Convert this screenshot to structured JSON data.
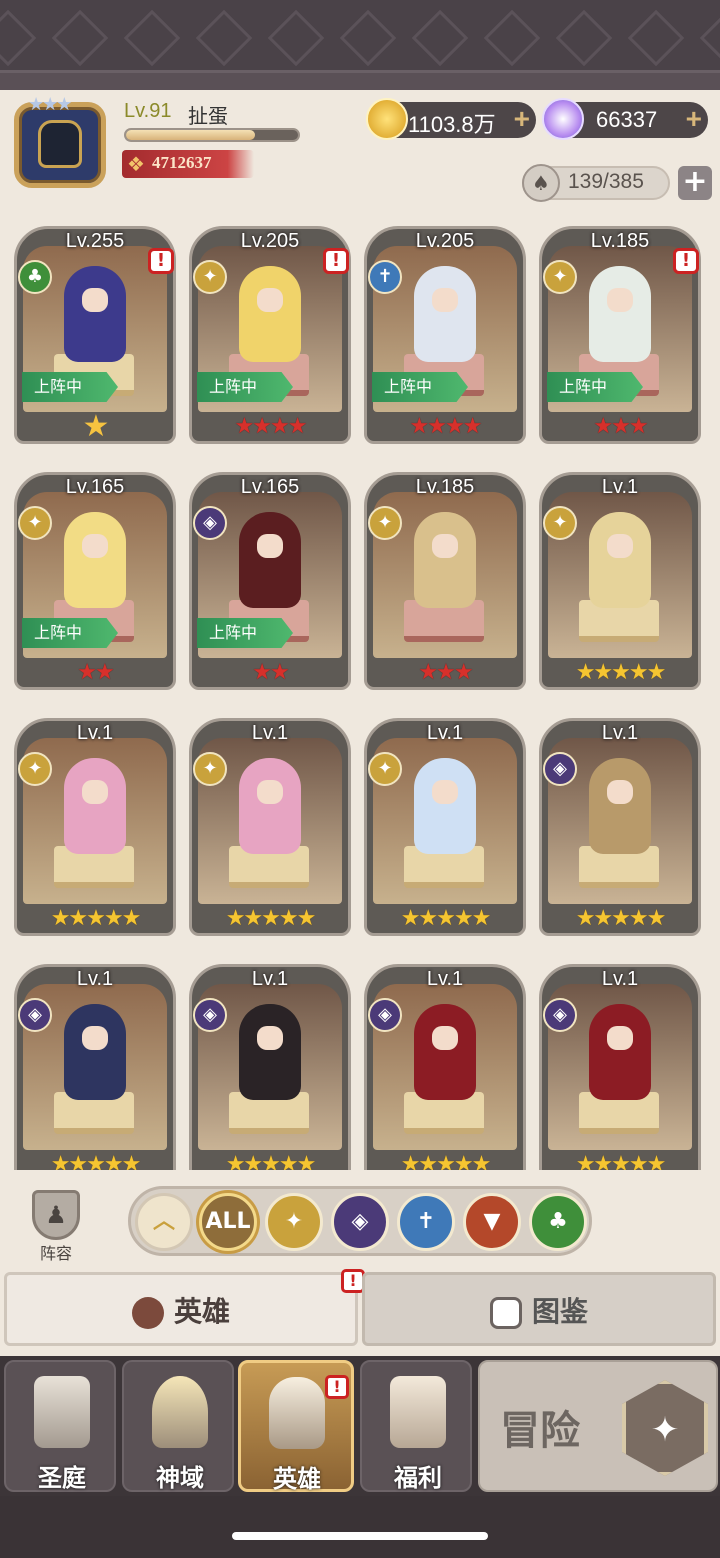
{
  "player": {
    "level": "Lv.91",
    "name": "扯蛋",
    "xp_fraction": 0.75,
    "power": "4712637"
  },
  "currency": {
    "gold": "1103.8万",
    "gems": "66337"
  },
  "capacity": "139/385",
  "heroes": [
    {
      "level": "Lv.255",
      "class": "nature",
      "alert": true,
      "deployed": true,
      "stars": "★",
      "star_style": "purple-wing"
    },
    {
      "level": "Lv.205",
      "class": "light",
      "alert": true,
      "deployed": true,
      "stars": "★★★★",
      "star_style": "red"
    },
    {
      "level": "Lv.205",
      "class": "holy",
      "alert": false,
      "deployed": true,
      "stars": "★★★★",
      "star_style": "red"
    },
    {
      "level": "Lv.185",
      "class": "light",
      "alert": true,
      "deployed": true,
      "stars": "★★★",
      "star_style": "red"
    },
    {
      "level": "Lv.165",
      "class": "light",
      "alert": false,
      "deployed": true,
      "stars": "★★",
      "star_style": "red"
    },
    {
      "level": "Lv.165",
      "class": "dark",
      "alert": false,
      "deployed": true,
      "stars": "★★",
      "star_style": "red"
    },
    {
      "level": "Lv.185",
      "class": "light",
      "alert": false,
      "deployed": false,
      "stars": "★★★",
      "star_style": "red"
    },
    {
      "level": "Lv.1",
      "class": "light",
      "alert": false,
      "deployed": false,
      "stars": "★★★★★",
      "star_style": "yellow"
    },
    {
      "level": "Lv.1",
      "class": "light",
      "alert": false,
      "deployed": false,
      "stars": "★★★★★",
      "star_style": "yellow"
    },
    {
      "level": "Lv.1",
      "class": "light",
      "alert": false,
      "deployed": false,
      "stars": "★★★★★",
      "star_style": "yellow"
    },
    {
      "level": "Lv.1",
      "class": "light",
      "alert": false,
      "deployed": false,
      "stars": "★★★★★",
      "star_style": "yellow"
    },
    {
      "level": "Lv.1",
      "class": "dark",
      "alert": false,
      "deployed": false,
      "stars": "★★★★★",
      "star_style": "yellow"
    },
    {
      "level": "Lv.1",
      "class": "dark",
      "alert": false,
      "deployed": false,
      "stars": "★★★★★",
      "star_style": "yellow"
    },
    {
      "level": "Lv.1",
      "class": "dark",
      "alert": false,
      "deployed": false,
      "stars": "★★★★★",
      "star_style": "yellow"
    },
    {
      "level": "Lv.1",
      "class": "dark",
      "alert": false,
      "deployed": false,
      "stars": "★★★★★",
      "star_style": "yellow"
    },
    {
      "level": "Lv.1",
      "class": "dark",
      "alert": false,
      "deployed": false,
      "stars": "★★★★★",
      "star_style": "yellow"
    }
  ],
  "deployed_label": "上阵中",
  "alert_mark": "!",
  "team_label": "阵容",
  "filters": {
    "all_label": "ALL",
    "items": [
      "collapse",
      "all",
      "light",
      "dark",
      "holy",
      "beast",
      "nature"
    ]
  },
  "tabs": {
    "hero": "英雄",
    "gallery": "图鉴"
  },
  "nav": {
    "sanctuary": "圣庭",
    "divine": "神域",
    "heroes": "英雄",
    "welfare": "福利",
    "adventure": "冒险"
  },
  "colors": {
    "light": "#c9a23c",
    "dark": "#4b3a78",
    "holy": "#3f79b8",
    "beast": "#b4482a",
    "nature": "#3f8f3a",
    "deployed": "#3fa760"
  }
}
